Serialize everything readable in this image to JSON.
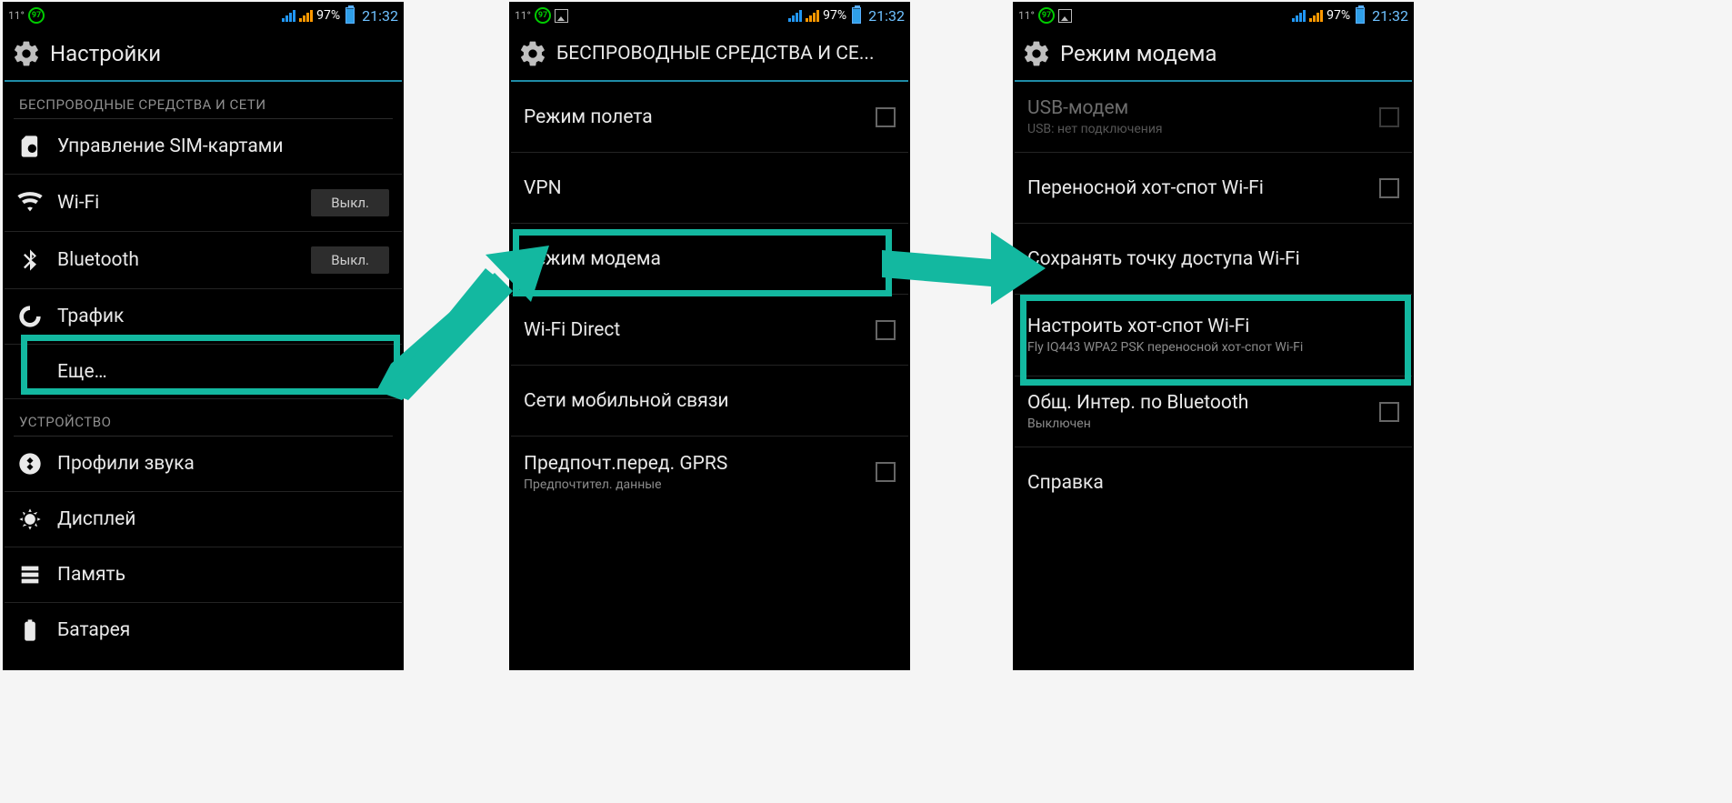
{
  "colors": {
    "accent": "#13b8a0",
    "titleUnderline": "#1f8ba7"
  },
  "status": {
    "temp": "11°",
    "badge": "97",
    "percent": "97%",
    "time": "21:32"
  },
  "screen1": {
    "title": "Настройки",
    "section1": "БЕСПРОВОДНЫЕ СРЕДСТВА И СЕТИ",
    "sim": "Управление SIM-картами",
    "wifi": "Wi-Fi",
    "wifiState": "Выкл.",
    "bt": "Bluetooth",
    "btState": "Выкл.",
    "traffic": "Трафик",
    "more": "Еще…",
    "section2": "УСТРОЙСТВО",
    "sound": "Профили звука",
    "display": "Дисплей",
    "memory": "Память",
    "battery": "Батарея"
  },
  "screen2": {
    "title": "БЕСПРОВОДНЫЕ СРЕДСТВА И СЕ...",
    "airplane": "Режим полета",
    "vpn": "VPN",
    "tether": "Режим модема",
    "wifidirect": "Wi-Fi Direct",
    "mobile": "Сети мобильной связи",
    "gprs": "Предпочт.перед. GPRS",
    "gprsSub": "Предпочтител. данные"
  },
  "screen3": {
    "title": "Режим модема",
    "usb": "USB-модем",
    "usbSub": "USB: нет подключения",
    "hotspot": "Переносной хот-спот Wi-Fi",
    "keepAp": "Сохранять точку доступа Wi-Fi",
    "configure": "Настроить хот-спот Wi-Fi",
    "configureSub": "Fly IQ443 WPA2 PSK переносной хот-спот Wi-Fi",
    "btShare": "Общ. Интер. по Bluetooth",
    "btShareSub": "Выключен",
    "help": "Справка"
  }
}
